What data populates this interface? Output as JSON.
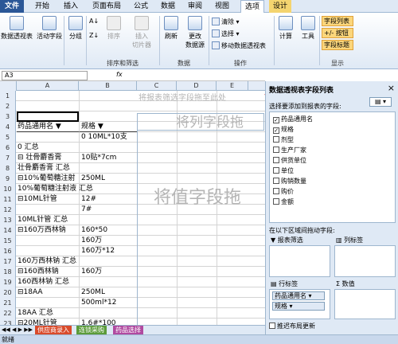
{
  "ribbon_tabs": [
    "文件",
    "开始",
    "插入",
    "页面布局",
    "公式",
    "数据",
    "审阅",
    "视图",
    "选项",
    "设计"
  ],
  "ribbon": {
    "pivot_table": "数据透视表",
    "active_field": "活动字段",
    "group": "分组",
    "sort": "排序",
    "insert_slicer": "插入\n切片器",
    "sort_filter_group": "排序和筛选",
    "refresh": "刷新",
    "change_source": "更改\n数据源",
    "data_group": "数据",
    "clear": "清除",
    "select": "选择",
    "move": "移动数据透视表",
    "actions_group": "操作",
    "calc": "计算",
    "tools": "工具",
    "field_list": "字段列表",
    "buttons": "+/- 按钮",
    "field_headers": "字段标题",
    "show_group": "显示"
  },
  "formula_bar": {
    "name_box": "A3",
    "fx": "fx"
  },
  "columns": [
    "A",
    "B",
    "C",
    "D",
    "E"
  ],
  "rows": [
    {
      "n": "1",
      "a": "",
      "b": ""
    },
    {
      "n": "2",
      "a": "",
      "b": ""
    },
    {
      "n": "3",
      "a": "",
      "b": ""
    },
    {
      "n": "4",
      "a": "药品通用名 ▼",
      "b": "规格 ▼"
    },
    {
      "n": "5",
      "a": "",
      "b": "0 10ML*10支"
    },
    {
      "n": "6",
      "a": "0 汇总",
      "b": ""
    },
    {
      "n": "7",
      "a": "⊟ 壮骨麝香膏",
      "b": "10贴*7cm"
    },
    {
      "n": "8",
      "a": "壮骨麝香膏 汇总",
      "b": ""
    },
    {
      "n": "9",
      "a": "⊟10%葡萄糖注射",
      "b": "250ML"
    },
    {
      "n": "10",
      "a": "10%葡萄糖注射液 汇总",
      "b": ""
    },
    {
      "n": "11",
      "a": "⊟10ML针管",
      "b": "12#"
    },
    {
      "n": "12",
      "a": "",
      "b": "7#"
    },
    {
      "n": "13",
      "a": "10ML针管 汇总",
      "b": ""
    },
    {
      "n": "14",
      "a": "⊟160万西林钠",
      "b": "160*50"
    },
    {
      "n": "15",
      "a": "",
      "b": "160万"
    },
    {
      "n": "16",
      "a": "",
      "b": "160万*12"
    },
    {
      "n": "17",
      "a": "160万西林钠 汇总",
      "b": ""
    },
    {
      "n": "18",
      "a": "⊟160西林钠",
      "b": "160万"
    },
    {
      "n": "19",
      "a": "160西林钠 汇总",
      "b": ""
    },
    {
      "n": "20",
      "a": "⊟18AA",
      "b": "250ML"
    },
    {
      "n": "21",
      "a": "",
      "b": "500ml*12"
    },
    {
      "n": "22",
      "a": "18AA 汇总",
      "b": ""
    },
    {
      "n": "23",
      "a": "⊟20ML针管",
      "b": "1.6#*100"
    }
  ],
  "drop_zones": {
    "filter": "将报表筛选字段拖至此处",
    "column": "将列字段拖",
    "value": "将值字段拖"
  },
  "sheet_tabs": [
    "供应商录入",
    "连锁采购",
    "药品选择"
  ],
  "status": "就绪",
  "pivot_panel": {
    "title": "数据透视表字段列表",
    "close": "×",
    "subtitle": "选择要添加到报表的字段:",
    "fields": [
      {
        "label": "药品通用名",
        "checked": true
      },
      {
        "label": "规格",
        "checked": true
      },
      {
        "label": "剂型",
        "checked": false
      },
      {
        "label": "生产厂家",
        "checked": false
      },
      {
        "label": "供货单位",
        "checked": false
      },
      {
        "label": "单位",
        "checked": false
      },
      {
        "label": "购销数量",
        "checked": false
      },
      {
        "label": "购价",
        "checked": false
      },
      {
        "label": "金额",
        "checked": false
      }
    ],
    "drag_hint": "在以下区域间拖动字段:",
    "report_filter": "报表筛选",
    "column_labels": "列标签",
    "row_labels": "行标签",
    "values": "数值",
    "row_chips": [
      "药品通用名",
      "规格"
    ],
    "defer": "推迟布局更新"
  },
  "colors": {
    "accent": "#2b5797",
    "design_tab": "#f4d46f",
    "highlight": "#fbd67b",
    "annotation": "#cc2222"
  }
}
